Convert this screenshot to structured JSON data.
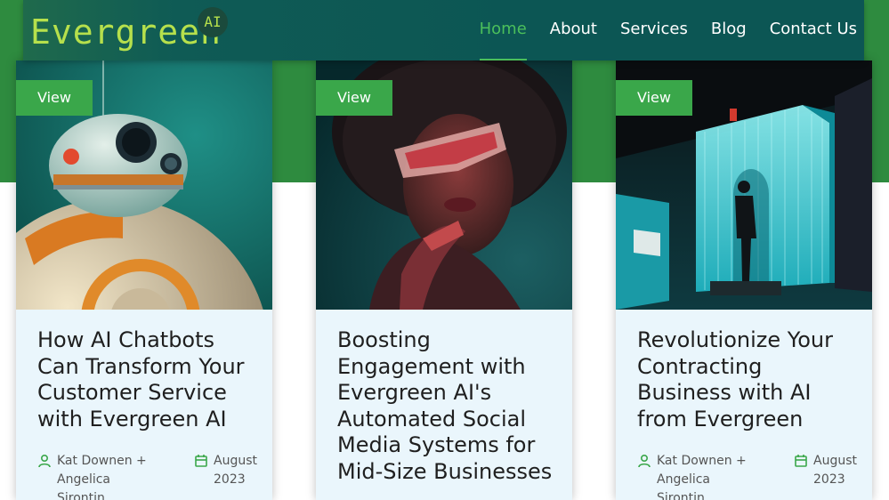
{
  "brand": {
    "name": "Evergreen",
    "badge": "AI"
  },
  "nav": {
    "items": [
      {
        "label": "Home",
        "active": true
      },
      {
        "label": "About"
      },
      {
        "label": "Services"
      },
      {
        "label": "Blog"
      },
      {
        "label": "Contact Us"
      }
    ]
  },
  "cards": [
    {
      "button": "View",
      "title": "How AI Chatbots Can Transform Your Customer Service with Evergreen AI",
      "author": "Kat Downen + Angelica Sirontin",
      "date": "August 2023"
    },
    {
      "button": "View",
      "title": "Boosting Engagement with Evergreen AI's Automated Social Media Systems for Mid-Size Businesses"
    },
    {
      "button": "View",
      "title": "Revolutionize Your Contracting Business with AI from Evergreen",
      "author": "Kat Downen + Angelica Sirontin",
      "date": "August 2023"
    }
  ],
  "colors": {
    "accent": "#3aa74a",
    "band": "#2e8b3f",
    "nav_bg": "#0c5654",
    "logo": "#b6e04c",
    "card_bg": "#eaf6fc"
  },
  "icons": {
    "author": "user-icon",
    "date": "calendar-icon"
  }
}
